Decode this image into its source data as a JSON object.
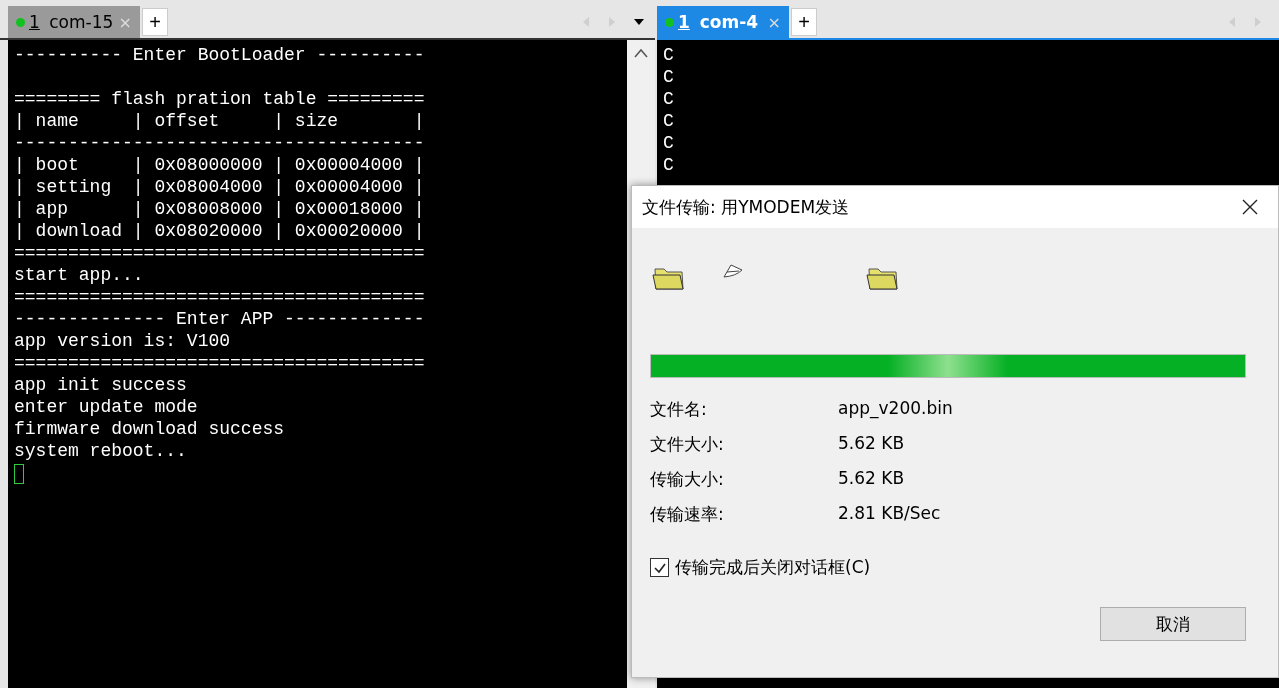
{
  "left_pane": {
    "tabs": [
      {
        "number": "1",
        "label": "com-15",
        "selected": false,
        "connected": true,
        "close": "×"
      }
    ],
    "add_tab": "+",
    "terminal": {
      "blocks": [
        {
          "lines": [
            "---------- Enter BootLoader ----------"
          ]
        },
        {
          "lines": [
            "======== flash pration table =========",
            "| name     | offset     | size       |",
            "--------------------------------------",
            "| boot     | 0x08000000 | 0x00004000 |",
            "| setting  | 0x08004000 | 0x00004000 |",
            "| app      | 0x08008000 | 0x00018000 |",
            "| download | 0x08020000 | 0x00020000 |",
            "======================================",
            "start app...",
            "======================================",
            "-------------- Enter APP -------------",
            "app version is: V100",
            "======================================",
            "app init success",
            "enter update mode",
            "firmware download success",
            "system reboot..."
          ]
        }
      ],
      "cursor": true
    }
  },
  "right_pane": {
    "tabs": [
      {
        "number": "1",
        "label": "com-4",
        "selected": true,
        "connected": true,
        "close": "×"
      }
    ],
    "add_tab": "+",
    "terminal": {
      "lines": [
        "C",
        "C",
        "C",
        "C",
        "C",
        "C"
      ]
    }
  },
  "dialog": {
    "title": "文件传输: 用YMODEM发送",
    "progress": {
      "level": 1.0
    },
    "fields": [
      {
        "label": "文件名:",
        "value": "app_v200.bin"
      },
      {
        "label": "文件大小:",
        "value": "5.62 KB"
      },
      {
        "label": "传输大小:",
        "value": "5.62 KB"
      },
      {
        "label": "传输速率:",
        "value": "2.81 KB/Sec"
      }
    ],
    "close_when_done": {
      "label": "传输完成后关闭对话框(C)",
      "checked": true
    },
    "cancel_button": "取消"
  }
}
